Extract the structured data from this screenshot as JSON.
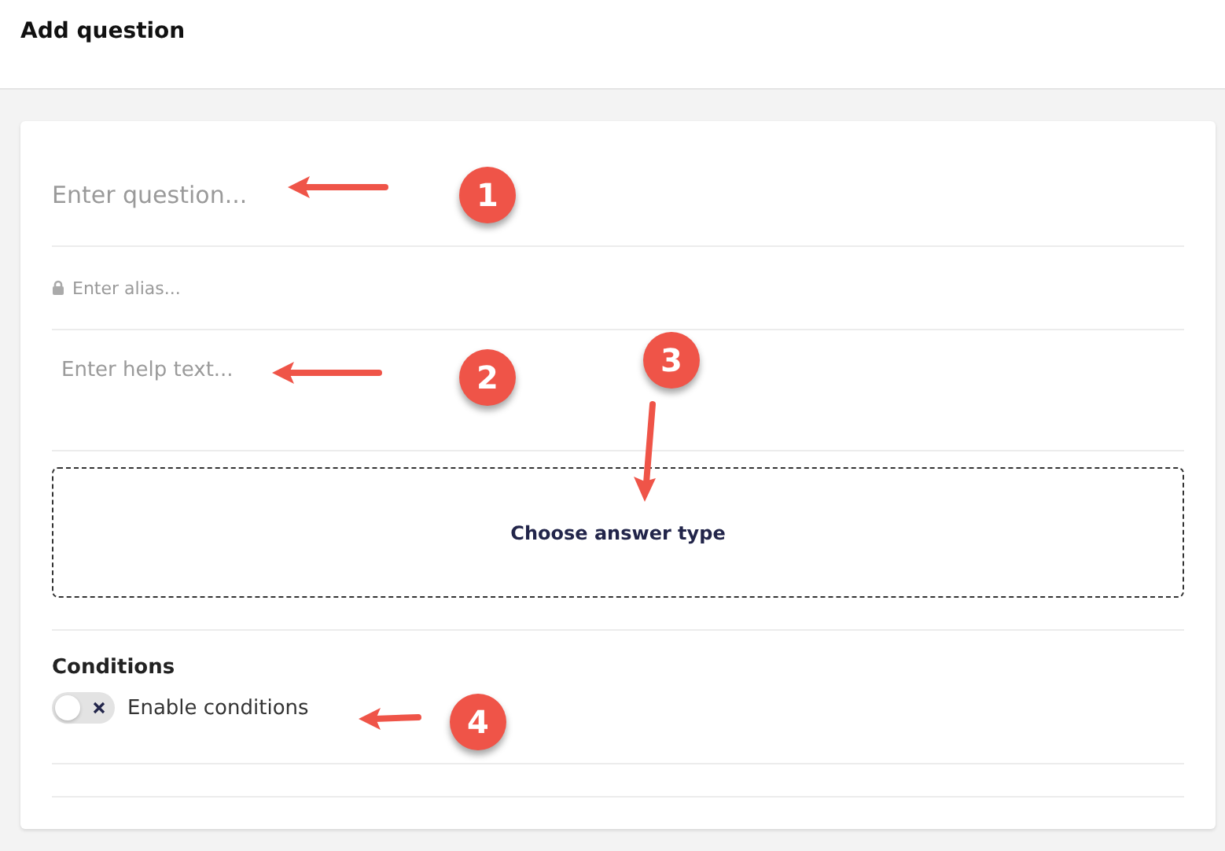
{
  "header": {
    "title": "Add question"
  },
  "form": {
    "question": {
      "placeholder": "Enter question..."
    },
    "alias": {
      "placeholder": "Enter alias..."
    },
    "help_text": {
      "placeholder": "Enter help text..."
    },
    "answer_type": {
      "label": "Choose answer type"
    },
    "conditions": {
      "title": "Conditions",
      "toggle": {
        "label": "Enable conditions",
        "on": false
      }
    }
  },
  "annotations": [
    {
      "number": "1"
    },
    {
      "number": "2"
    },
    {
      "number": "3"
    },
    {
      "number": "4"
    }
  ]
}
